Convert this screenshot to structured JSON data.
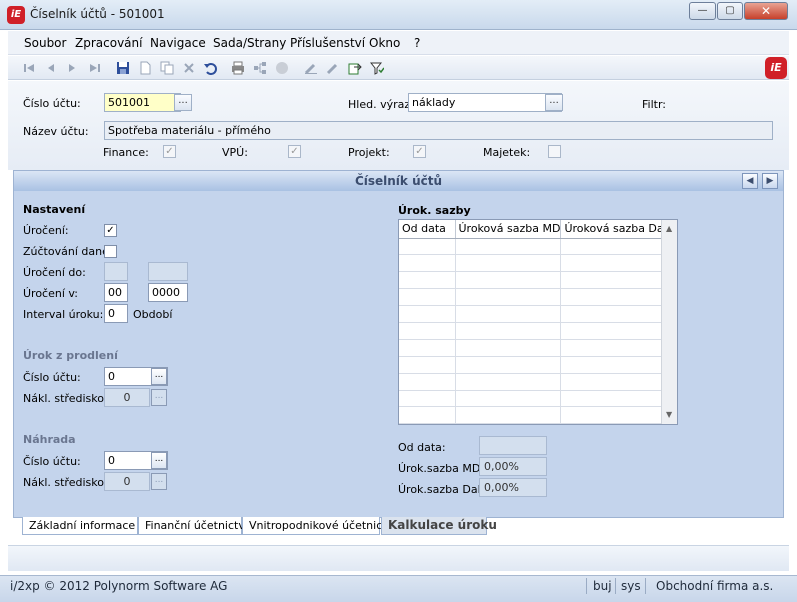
{
  "window": {
    "title": "Číselník účtů - 501001",
    "app_logo": "iE",
    "minimize": "—",
    "maximize": "▢",
    "close": "✕"
  },
  "menu": [
    "Soubor",
    "Zpracování",
    "Navigace",
    "Sada/Strany",
    "Příslušenství",
    "Okno",
    "?"
  ],
  "toolbar_icons": [
    "first-icon",
    "prev-icon",
    "next-icon",
    "last-icon",
    "save-icon",
    "new-icon",
    "copy-icon",
    "delete-icon",
    "undo-icon",
    "print-icon",
    "tree-icon",
    "disabled-circle-icon",
    "edit-icon",
    "edit2-icon",
    "export-icon",
    "filter-icon"
  ],
  "form": {
    "account_no_label": "Číslo účtu:",
    "account_no_value": "501001",
    "search_label": "Hled. výraz:",
    "search_value": "náklady",
    "filter_label": "Filtr:",
    "name_label": "Název účtu:",
    "name_value": "Spotřeba materiálu - přímého",
    "flags": [
      {
        "label": "Finance:",
        "checked": true
      },
      {
        "label": "VPÚ:",
        "checked": true
      },
      {
        "label": "Projekt:",
        "checked": true
      },
      {
        "label": "Majetek:",
        "checked": false
      }
    ],
    "dots": "..."
  },
  "panel": {
    "title": "Číselník účtů",
    "nastaveni": {
      "heading": "Nastavení",
      "uroceni_label": "Úročení:",
      "uroceni_checked": true,
      "zuctovani_label": "Zúčtování daně:",
      "uroceni_do_label": "Úročení do:",
      "uroceni_v_label": "Úročení v:",
      "uroceni_v_value1": "00",
      "uroceni_v_value2": "0000",
      "interval_label": "Interval úroku:",
      "interval_value": "0",
      "obdobi_label": "Období"
    },
    "prodleni": {
      "heading": "Úrok z prodlení",
      "cislo_label": "Číslo účtu:",
      "cislo_value": "0",
      "stredisko_label": "Nákl. středisko:",
      "stredisko_value": "0"
    },
    "nahrada": {
      "heading": "Náhrada",
      "cislo_label": "Číslo účtu:",
      "cislo_value": "0",
      "stredisko_label": "Nákl. středisko:",
      "stredisko_value": "0"
    },
    "sazby": {
      "heading": "Úrok. sazby",
      "columns": [
        "Od data",
        "Úroková sazba MD",
        "Úroková sazba Dal"
      ],
      "od_data_label": "Od data:",
      "md_label": "Úrok.sazba MD:",
      "md_value": "0,00%",
      "dal_label": "Úrok.sazba Dal:",
      "dal_value": "0,00%"
    }
  },
  "tabs": [
    "Základní informace",
    "Finanční účetnictví",
    "Vnitropodnikové účetnictví",
    "Kalkulace úroku"
  ],
  "status": {
    "copyright": "i/2xp © 2012 Polynorm Software AG",
    "user": "buj",
    "sys": "sys",
    "company": "Obchodní firma a.s."
  }
}
